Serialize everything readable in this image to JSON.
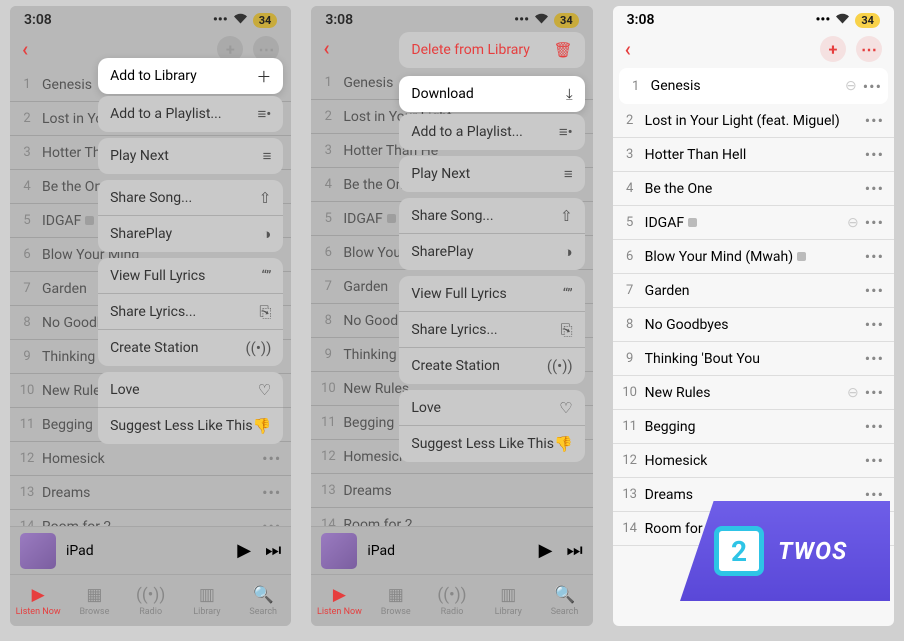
{
  "status": {
    "time": "3:08",
    "battery": "34"
  },
  "tracks": [
    {
      "num": "1",
      "title": "Genesis",
      "explicit": false
    },
    {
      "num": "2",
      "title_short": "Lost in Your Light",
      "title_full": "Lost in Your Light (feat. Miguel)",
      "explicit": false
    },
    {
      "num": "3",
      "title_short": "Hotter Than Hell",
      "title_full": "Hotter Than Hell",
      "explicit": false
    },
    {
      "num": "4",
      "title": "Be the One",
      "explicit": false
    },
    {
      "num": "5",
      "title": "IDGAF",
      "explicit": true
    },
    {
      "num": "6",
      "title_short": "Blow Your Mind",
      "title_full": "Blow Your Mind (Mwah)",
      "explicit": true
    },
    {
      "num": "7",
      "title": "Garden",
      "explicit": false
    },
    {
      "num": "8",
      "title": "No Goodbyes",
      "explicit": false
    },
    {
      "num": "9",
      "title_short": "Thinking 'Bout You",
      "title_full": "Thinking 'Bout You",
      "explicit": false
    },
    {
      "num": "10",
      "title": "New Rules",
      "explicit": false
    },
    {
      "num": "11",
      "title": "Begging",
      "explicit": false
    },
    {
      "num": "12",
      "title": "Homesick",
      "explicit": false
    },
    {
      "num": "13",
      "title": "Dreams",
      "explicit": false
    },
    {
      "num": "14",
      "title": "Room for 2",
      "explicit": false
    }
  ],
  "menu1": {
    "add_to_library": "Add to Library",
    "add_to_playlist": "Add to a Playlist...",
    "play_next": "Play Next",
    "share_song": "Share Song...",
    "shareplay": "SharePlay",
    "view_full_lyrics": "View Full Lyrics",
    "share_lyrics": "Share Lyrics...",
    "create_station": "Create Station",
    "love": "Love",
    "suggest_less": "Suggest Less Like This"
  },
  "menu2": {
    "delete_from_library": "Delete from Library",
    "download": "Download",
    "add_to_playlist": "Add to a Playlist...",
    "play_next": "Play Next",
    "share_song": "Share Song...",
    "shareplay": "SharePlay",
    "view_full_lyrics": "View Full Lyrics",
    "share_lyrics": "Share Lyrics...",
    "create_station": "Create Station",
    "love": "Love",
    "suggest_less": "Suggest Less Like This"
  },
  "now_playing": {
    "title": "iPad"
  },
  "tabs": {
    "listen_now": "Listen Now",
    "browse": "Browse",
    "radio": "Radio",
    "library": "Library",
    "search": "Search"
  },
  "logo": {
    "text": "TWOS",
    "badge": "2"
  }
}
